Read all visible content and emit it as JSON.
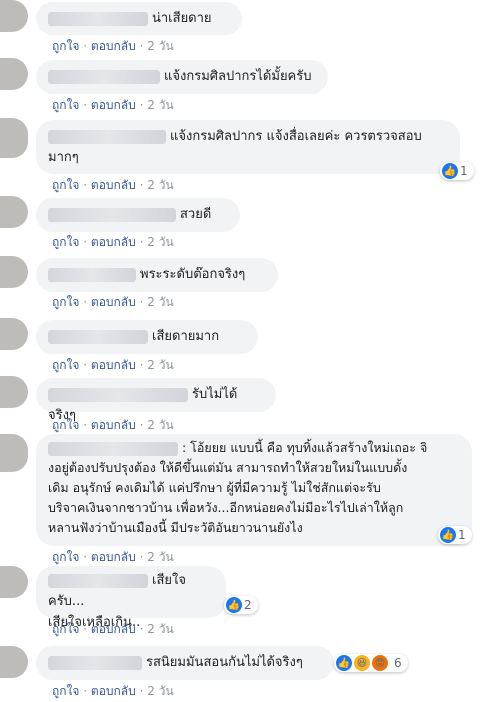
{
  "labels": {
    "like": "ถูกใจ",
    "reply": "ตอบกลับ",
    "sep": "·"
  },
  "comments": [
    {
      "text": "น่าเสียดาย",
      "time": "2 วัน"
    },
    {
      "text": "แจ้งกรมศิลปากรได้มั้ยครับ",
      "time": "2 วัน"
    },
    {
      "text_line1": "แจ้งกรมศิลปากร แจ้งสื่อเลยค่ะ ควรตรวจสอบ",
      "text_line2": "มากๆ",
      "time": "2 วัน",
      "reactions": {
        "icon": "like-icon",
        "count": "1"
      }
    },
    {
      "text": "สวยดี",
      "time": "2 วัน"
    },
    {
      "text": "พระระดับต๊อกจริงๆ",
      "time": "2 วัน"
    },
    {
      "text": "เสียดายมาก",
      "time": "2 วัน"
    },
    {
      "text": "รับไม่ได้จริงๆ",
      "time": "2 วัน"
    },
    {
      "text_line1": ": โอ้ยยย แบบนี้ คือ ทุบทิ้งแล้วสร้างใหม่เถอะ จิ",
      "text_line2": "งอยู่ต้องปรับปรุงต้อง ให้ดีขึ้นแต่มัน สามารถทำให้สวยใหม่ในแบบดั้ง",
      "text_line3": "เดิม อนุรักษ์ คงเดิมได้ แค่ปรึกษา ผู้ที่มีความรู้ ไม่ใช่สักแต่จะรับ",
      "text_line4": "บริจาคเงินจากชาวบ้าน เพื่อหวัง...อีกหน่อยคงไม่มีอะไรไปเล่าให้ลูก",
      "text_line5": "หลานฟังว่าบ้านเมืองนี้ มีประวัติอันยาวนานยังไง",
      "time": "2 วัน",
      "reactions": {
        "icon": "like-icon",
        "count": "1"
      }
    },
    {
      "text_line1": "เสียใจครับ...",
      "text_line2": "เสียใจเหลือเกิน..",
      "time": "2 วัน",
      "reactions": {
        "icon": "like-icon",
        "count": "2"
      }
    },
    {
      "text": "รสนิยมมันสอนกันไม่ได้จริงๆ",
      "time": "2 วัน",
      "reactions": {
        "icons": [
          "like-icon",
          "haha-icon",
          "angry-icon"
        ],
        "count": "6"
      }
    }
  ],
  "colors": {
    "bubble": "#f2f3f5",
    "link": "#385898",
    "meta": "#8d949e",
    "like": "#1877f2"
  }
}
